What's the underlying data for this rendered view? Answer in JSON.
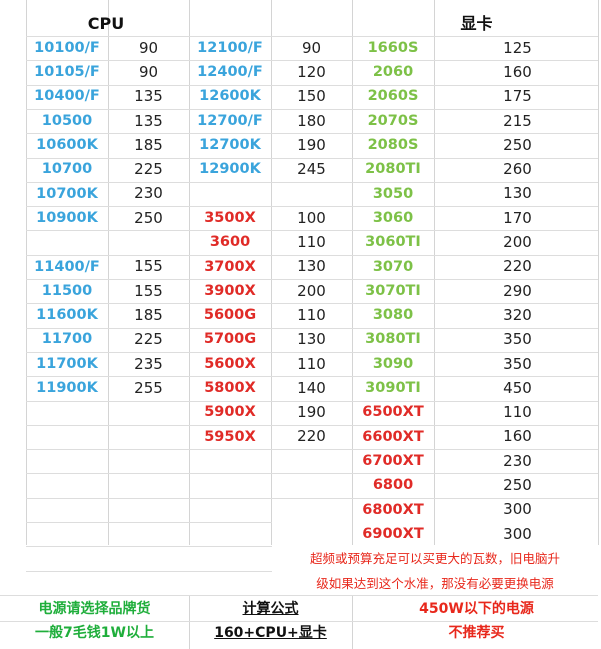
{
  "headers": {
    "cpu": "CPU",
    "gpu": "显卡"
  },
  "colors": {
    "intel": "#3aa4dc",
    "amd": "#e02b27",
    "gpu": "#7dc147",
    "note_red": "#e8281c",
    "note_green": "#1fae3b"
  },
  "intel_col1": [
    {
      "name": "10100/F",
      "watt": "90"
    },
    {
      "name": "10105/F",
      "watt": "90"
    },
    {
      "name": "10400/F",
      "watt": "135"
    },
    {
      "name": "10500",
      "watt": "135"
    },
    {
      "name": "10600K",
      "watt": "185"
    },
    {
      "name": "10700",
      "watt": "225"
    },
    {
      "name": "10700K",
      "watt": "230"
    },
    {
      "name": "10900K",
      "watt": "250"
    },
    {
      "name": "",
      "watt": ""
    },
    {
      "name": "11400/F",
      "watt": "155"
    },
    {
      "name": "11500",
      "watt": "155"
    },
    {
      "name": "11600K",
      "watt": "185"
    },
    {
      "name": "11700",
      "watt": "225"
    },
    {
      "name": "11700K",
      "watt": "235"
    },
    {
      "name": "11900K",
      "watt": "255"
    }
  ],
  "col2": [
    {
      "name": "12100/F",
      "watt": "90",
      "brand": "intel"
    },
    {
      "name": "12400/F",
      "watt": "120",
      "brand": "intel"
    },
    {
      "name": "12600K",
      "watt": "150",
      "brand": "intel"
    },
    {
      "name": "12700/F",
      "watt": "180",
      "brand": "intel"
    },
    {
      "name": "12700K",
      "watt": "190",
      "brand": "intel"
    },
    {
      "name": "12900K",
      "watt": "245",
      "brand": "intel"
    },
    {
      "name": "",
      "watt": "",
      "brand": "intel"
    },
    {
      "name": "3500X",
      "watt": "100",
      "brand": "amd"
    },
    {
      "name": "3600",
      "watt": "110",
      "brand": "amd"
    },
    {
      "name": "3700X",
      "watt": "130",
      "brand": "amd"
    },
    {
      "name": "3900X",
      "watt": "200",
      "brand": "amd"
    },
    {
      "name": "5600G",
      "watt": "110",
      "brand": "amd"
    },
    {
      "name": "5700G",
      "watt": "130",
      "brand": "amd"
    },
    {
      "name": "5600X",
      "watt": "110",
      "brand": "amd"
    },
    {
      "name": "5800X",
      "watt": "140",
      "brand": "amd"
    },
    {
      "name": "5900X",
      "watt": "190",
      "brand": "amd"
    },
    {
      "name": "5950X",
      "watt": "220",
      "brand": "amd"
    }
  ],
  "gpus": [
    {
      "name": "1660S",
      "watt": "125",
      "brand": "gpu"
    },
    {
      "name": "2060",
      "watt": "160",
      "brand": "gpu"
    },
    {
      "name": "2060S",
      "watt": "175",
      "brand": "gpu"
    },
    {
      "name": "2070S",
      "watt": "215",
      "brand": "gpu"
    },
    {
      "name": "2080S",
      "watt": "250",
      "brand": "gpu"
    },
    {
      "name": "2080TI",
      "watt": "260",
      "brand": "gpu"
    },
    {
      "name": "3050",
      "watt": "130",
      "brand": "gpu"
    },
    {
      "name": "3060",
      "watt": "170",
      "brand": "gpu"
    },
    {
      "name": "3060TI",
      "watt": "200",
      "brand": "gpu"
    },
    {
      "name": "3070",
      "watt": "220",
      "brand": "gpu"
    },
    {
      "name": "3070TI",
      "watt": "290",
      "brand": "gpu"
    },
    {
      "name": "3080",
      "watt": "320",
      "brand": "gpu"
    },
    {
      "name": "3080TI",
      "watt": "350",
      "brand": "gpu"
    },
    {
      "name": "3090",
      "watt": "350",
      "brand": "gpu"
    },
    {
      "name": "3090TI",
      "watt": "450",
      "brand": "gpu"
    },
    {
      "name": "6500XT",
      "watt": "110",
      "brand": "amd"
    },
    {
      "name": "6600XT",
      "watt": "160",
      "brand": "amd"
    },
    {
      "name": "6700XT",
      "watt": "230",
      "brand": "amd"
    },
    {
      "name": "6800",
      "watt": "250",
      "brand": "amd"
    },
    {
      "name": "6800XT",
      "watt": "300",
      "brand": "amd"
    },
    {
      "name": "6900XT",
      "watt": "300",
      "brand": "amd"
    }
  ],
  "note": {
    "line1": "超频或预算充足可以买更大的瓦数，旧电脑升",
    "line2": "级如果达到这个水准，那没有必要更换电源"
  },
  "footer": {
    "psu_line1": "电源请选择品牌货",
    "psu_line2": "一般7毛钱1W以上",
    "formula_title": "计算公式",
    "formula": "160+CPU+显卡",
    "warn_line1": "450W以下的电源",
    "warn_line2": "不推荐买"
  }
}
